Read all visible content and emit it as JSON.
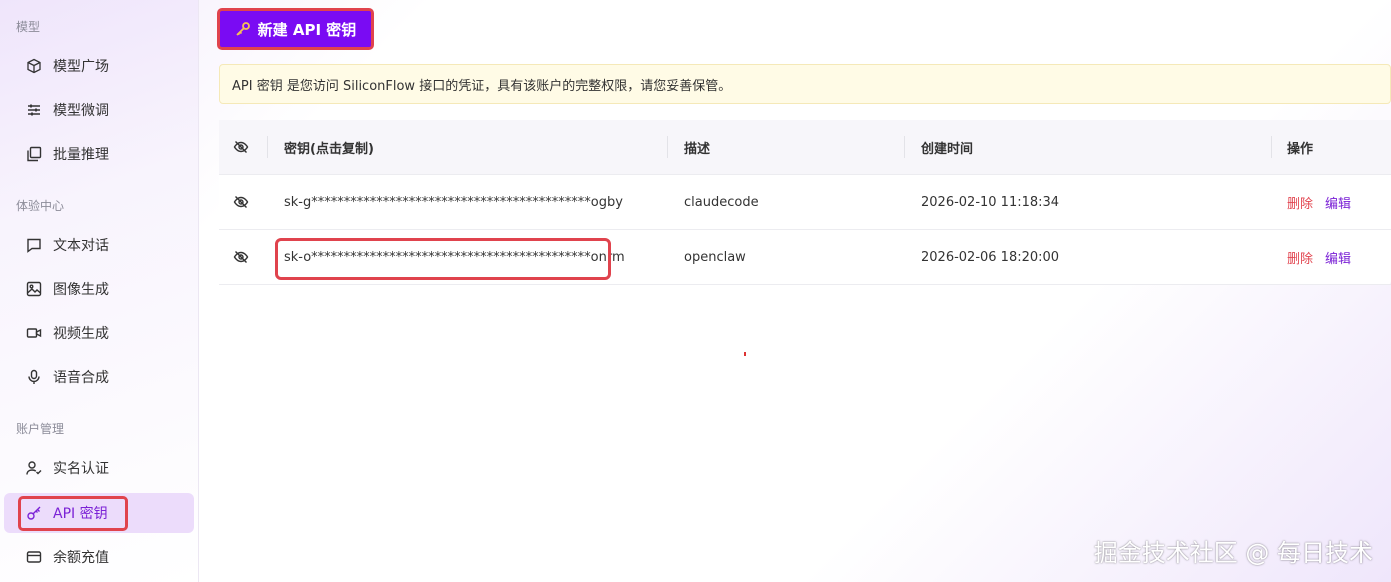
{
  "sidebar": {
    "sections": [
      {
        "title": "模型"
      },
      {
        "title": "体验中心"
      },
      {
        "title": "账户管理"
      }
    ],
    "items": [
      {
        "label": "模型广场",
        "icon": "cube-icon"
      },
      {
        "label": "模型微调",
        "icon": "sliders-icon"
      },
      {
        "label": "批量推理",
        "icon": "batch-icon"
      },
      {
        "label": "文本对话",
        "icon": "chat-icon"
      },
      {
        "label": "图像生成",
        "icon": "image-icon"
      },
      {
        "label": "视频生成",
        "icon": "video-icon"
      },
      {
        "label": "语音合成",
        "icon": "mic-icon"
      },
      {
        "label": "实名认证",
        "icon": "user-check-icon"
      },
      {
        "label": "API 密钥",
        "icon": "key-icon",
        "active": true
      },
      {
        "label": "余额充值",
        "icon": "wallet-icon"
      }
    ]
  },
  "toolbar": {
    "new_key_label": "新建 API 密钥"
  },
  "notice": {
    "text": "API 密钥 是您访问 SiliconFlow 接口的凭证，具有该账户的完整权限，请您妥善保管。"
  },
  "table": {
    "columns": [
      "密钥(点击复制)",
      "描述",
      "创建时间",
      "操作"
    ],
    "rows": [
      {
        "key": "sk-g*******************************************ogby",
        "description": "claudecode",
        "created": "2026-02-10 11:18:34",
        "delete": "删除",
        "edit": "编辑"
      },
      {
        "key": "sk-o*******************************************onrm",
        "description": "openclaw",
        "created": "2026-02-06 18:20:00",
        "delete": "删除",
        "edit": "编辑"
      }
    ]
  },
  "watermark": "掘金技术社区 @ 每日技术",
  "colors": {
    "accent": "#7a0bf3",
    "active_bg": "#ecdcfb",
    "delete": "#e2444f",
    "highlight_box": "#e0434d",
    "notice_bg": "#fffbe6"
  }
}
